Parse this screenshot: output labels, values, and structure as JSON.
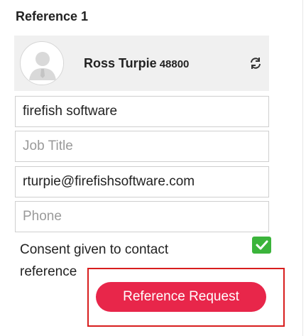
{
  "section": {
    "title": "Reference 1"
  },
  "contact": {
    "name": "Ross Turpie",
    "id": "48800",
    "avatar_icon": "user-avatar-icon",
    "refresh_icon": "refresh-icon"
  },
  "fields": {
    "company": {
      "value": "firefish software",
      "placeholder": ""
    },
    "job_title": {
      "value": "",
      "placeholder": "Job Title"
    },
    "email": {
      "value": "rturpie@firefishsoftware.com",
      "placeholder": ""
    },
    "phone": {
      "value": "",
      "placeholder": "Phone"
    }
  },
  "consent": {
    "label": "Consent given to contact reference",
    "checked": true,
    "check_color": "#3bb43b"
  },
  "actions": {
    "reference_request_label": "Reference Request",
    "button_color": "#e8264a",
    "highlight_color": "#d81e1e"
  }
}
